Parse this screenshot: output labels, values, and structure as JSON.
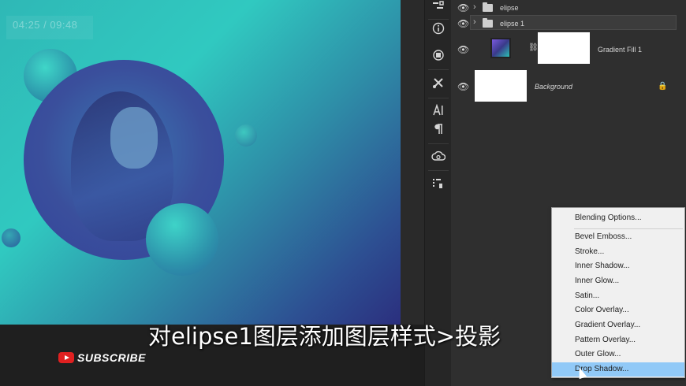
{
  "video": {
    "timecode": "04:25 / 09:48",
    "subtitle": "对elipse1图层添加图层样式>投影",
    "subscribe_label": "SUBSCRIBE"
  },
  "tool_icons": [
    "history-icon",
    "info-icon",
    "libraries-icon",
    "tools-icon",
    "character-icon",
    "paragraph-icon",
    "creative-cloud-icon",
    "properties-icon"
  ],
  "layers": {
    "items": [
      {
        "name": "elipse",
        "type": "group"
      },
      {
        "name": "elipse 1",
        "type": "group",
        "selected": true
      },
      {
        "name": "Gradient Fill 1",
        "type": "fill"
      },
      {
        "name": "Background",
        "type": "background",
        "locked": true
      }
    ]
  },
  "context_menu": {
    "items": [
      "Blending Options...",
      "Bevel  Emboss...",
      "Stroke...",
      "Inner Shadow...",
      "Inner Glow...",
      "Satin...",
      "Color Overlay...",
      "Gradient Overlay...",
      "Pattern Overlay...",
      "Outer Glow...",
      "Drop Shadow..."
    ],
    "selected": "Drop Shadow..."
  },
  "colors": {
    "accent_selection": "#91c9f7",
    "youtube_red": "#e02020"
  }
}
